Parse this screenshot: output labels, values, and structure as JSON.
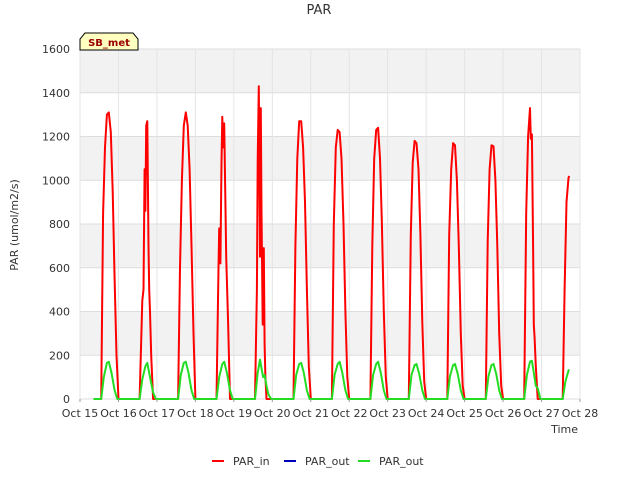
{
  "chart_data": {
    "type": "line",
    "title": "PAR",
    "xlabel": "Time",
    "ylabel": "PAR (umol/m2/s)",
    "site_label": "SB_met",
    "xlim": [
      15.0,
      28.0
    ],
    "ylim": [
      0,
      1600
    ],
    "y_ticks": [
      0,
      200,
      400,
      600,
      800,
      1000,
      1200,
      1400,
      1600
    ],
    "x_ticks": [
      {
        "value": 15,
        "label": "Oct 15"
      },
      {
        "value": 16,
        "label": "Oct 16"
      },
      {
        "value": 17,
        "label": "Oct 17"
      },
      {
        "value": 18,
        "label": "Oct 18"
      },
      {
        "value": 19,
        "label": "Oct 19"
      },
      {
        "value": 20,
        "label": "Oct 20"
      },
      {
        "value": 21,
        "label": "Oct 21"
      },
      {
        "value": 22,
        "label": "Oct 22"
      },
      {
        "value": 23,
        "label": "Oct 23"
      },
      {
        "value": 24,
        "label": "Oct 24"
      },
      {
        "value": 25,
        "label": "Oct 25"
      },
      {
        "value": 26,
        "label": "Oct 26"
      },
      {
        "value": 27,
        "label": "Oct 27"
      },
      {
        "value": 28,
        "label": "Oct 28"
      }
    ],
    "grid": true,
    "legend_placement": "bottom-center",
    "series": [
      {
        "name": "PAR_in",
        "color": "#ff0000",
        "x": [
          15.35,
          15.55,
          15.6,
          15.65,
          15.7,
          15.75,
          15.8,
          15.85,
          15.9,
          15.95,
          16.0,
          16.55,
          16.62,
          16.65,
          16.68,
          16.7,
          16.72,
          16.75,
          16.78,
          16.8,
          16.82,
          16.85,
          16.9,
          16.95,
          17.0,
          17.55,
          17.6,
          17.65,
          17.7,
          17.75,
          17.8,
          17.85,
          17.9,
          17.95,
          18.0,
          18.55,
          18.6,
          18.62,
          18.65,
          18.68,
          18.7,
          18.72,
          18.75,
          18.78,
          18.8,
          18.85,
          18.9,
          18.95,
          19.0,
          19.55,
          19.6,
          19.62,
          19.65,
          19.68,
          19.7,
          19.72,
          19.75,
          19.78,
          19.8,
          19.82,
          19.85,
          19.9,
          19.95,
          20.0,
          20.55,
          20.6,
          20.65,
          20.7,
          20.75,
          20.8,
          20.85,
          20.9,
          20.95,
          21.0,
          21.55,
          21.6,
          21.65,
          21.7,
          21.75,
          21.8,
          21.85,
          21.9,
          21.95,
          22.0,
          22.55,
          22.6,
          22.65,
          22.7,
          22.75,
          22.8,
          22.85,
          22.9,
          22.95,
          23.0,
          23.55,
          23.6,
          23.65,
          23.7,
          23.75,
          23.8,
          23.85,
          23.9,
          23.95,
          24.0,
          24.55,
          24.6,
          24.65,
          24.7,
          24.75,
          24.8,
          24.85,
          24.9,
          24.95,
          25.0,
          25.55,
          25.6,
          25.65,
          25.7,
          25.75,
          25.8,
          25.85,
          25.9,
          25.95,
          26.0,
          26.55,
          26.6,
          26.65,
          26.7,
          26.72,
          26.75,
          26.78,
          26.8,
          26.82,
          26.85,
          26.9,
          26.95,
          27.0,
          27.55,
          27.6,
          27.65,
          27.7,
          27.72
        ],
        "y": [
          0,
          0,
          850,
          1150,
          1300,
          1310,
          1220,
          950,
          550,
          200,
          0,
          0,
          450,
          500,
          1050,
          860,
          1250,
          1270,
          700,
          500,
          400,
          200,
          0,
          0,
          0,
          0,
          600,
          1000,
          1250,
          1310,
          1250,
          1050,
          700,
          300,
          0,
          0,
          600,
          780,
          620,
          1080,
          1290,
          1150,
          1260,
          900,
          650,
          350,
          0,
          0,
          0,
          0,
          500,
          1090,
          1430,
          650,
          1330,
          860,
          340,
          690,
          250,
          100,
          0,
          0,
          0,
          0,
          0,
          700,
          1100,
          1270,
          1270,
          1150,
          900,
          500,
          150,
          0,
          0,
          800,
          1150,
          1230,
          1220,
          1100,
          800,
          400,
          100,
          0,
          0,
          700,
          1100,
          1230,
          1240,
          1100,
          800,
          400,
          100,
          0,
          0,
          750,
          1080,
          1180,
          1170,
          1050,
          750,
          350,
          80,
          0,
          0,
          750,
          1050,
          1170,
          1160,
          1000,
          700,
          300,
          60,
          0,
          0,
          720,
          1050,
          1160,
          1155,
          1000,
          700,
          300,
          60,
          0,
          0,
          850,
          1200,
          1330,
          1190,
          1210,
          700,
          340,
          280,
          150,
          0,
          0,
          0,
          0,
          500,
          900,
          1010,
          1020
        ]
      },
      {
        "name": "PAR_out",
        "color": "#0000bb",
        "x": [],
        "y": []
      },
      {
        "name": "PAR_out",
        "color": "#22dd22",
        "x": [
          15.35,
          15.55,
          15.62,
          15.7,
          15.75,
          15.82,
          15.9,
          15.97,
          16.55,
          16.62,
          16.7,
          16.75,
          16.82,
          16.9,
          16.97,
          17.55,
          17.62,
          17.7,
          17.75,
          17.82,
          17.9,
          17.97,
          18.55,
          18.62,
          18.7,
          18.75,
          18.82,
          18.9,
          18.97,
          19.55,
          19.62,
          19.68,
          19.72,
          19.76,
          19.8,
          19.85,
          19.9,
          19.97,
          20.55,
          20.62,
          20.7,
          20.75,
          20.82,
          20.9,
          20.97,
          21.55,
          21.62,
          21.7,
          21.75,
          21.82,
          21.9,
          21.97,
          22.55,
          22.62,
          22.7,
          22.75,
          22.82,
          22.9,
          22.97,
          23.55,
          23.62,
          23.7,
          23.75,
          23.82,
          23.9,
          23.97,
          24.55,
          24.62,
          24.7,
          24.75,
          24.82,
          24.9,
          24.97,
          25.55,
          25.62,
          25.7,
          25.75,
          25.82,
          25.9,
          25.97,
          26.55,
          26.62,
          26.7,
          26.75,
          26.8,
          26.85,
          26.9,
          26.97,
          27.55,
          27.62,
          27.7,
          27.72
        ],
        "y": [
          0,
          0,
          100,
          165,
          170,
          120,
          40,
          0,
          0,
          90,
          150,
          165,
          100,
          30,
          0,
          0,
          110,
          165,
          170,
          120,
          40,
          0,
          0,
          100,
          160,
          170,
          120,
          40,
          0,
          0,
          120,
          180,
          140,
          100,
          110,
          60,
          20,
          0,
          0,
          110,
          160,
          165,
          120,
          40,
          0,
          0,
          110,
          160,
          170,
          120,
          40,
          0,
          0,
          110,
          160,
          170,
          120,
          40,
          0,
          0,
          110,
          155,
          160,
          115,
          40,
          0,
          0,
          105,
          155,
          160,
          115,
          40,
          0,
          0,
          105,
          155,
          160,
          115,
          40,
          0,
          0,
          110,
          170,
          175,
          120,
          60,
          50,
          0,
          0,
          80,
          130,
          135
        ]
      }
    ]
  }
}
